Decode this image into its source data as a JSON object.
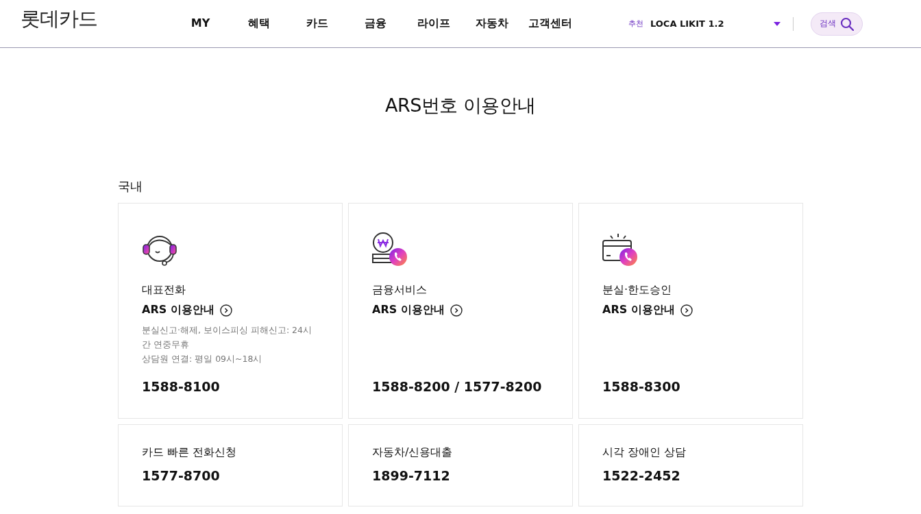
{
  "header": {
    "logo": "롯데카드",
    "nav": [
      {
        "label": "MY"
      },
      {
        "label": "혜택"
      },
      {
        "label": "카드"
      },
      {
        "label": "금융"
      },
      {
        "label": "라이프"
      },
      {
        "label": "자동차"
      },
      {
        "label": "고객센터"
      }
    ],
    "recommend": {
      "tag": "추천",
      "value": "LOCA LIKIT 1.2"
    },
    "search_button": "검색"
  },
  "page_title": "ARS번호 이용안내",
  "section": {
    "title": "국내",
    "cards": [
      {
        "kind": "headset",
        "title": "대표전화",
        "link": "ARS 이용안내",
        "notes": [
          "분실신고·해제, 보이스피싱 피해신고: 24시간 연중무휴",
          "상담원 연결: 평일 09시~18시"
        ],
        "phone": "1588-8100"
      },
      {
        "kind": "coin",
        "title": "금융서비스",
        "link": "ARS 이용안내",
        "phone": "1588-8200 / 1577-8200"
      },
      {
        "kind": "card",
        "title": "분실·한도승인",
        "link": "ARS 이용안내",
        "phone": "1588-8300"
      }
    ],
    "small_cards": [
      {
        "title": "카드 빠른 전화신청",
        "phone": "1577-8700"
      },
      {
        "title": "자동차/신용대출",
        "phone": "1899-7112"
      },
      {
        "title": "시각 장애인 상담",
        "phone": "1522-2452"
      }
    ]
  }
}
